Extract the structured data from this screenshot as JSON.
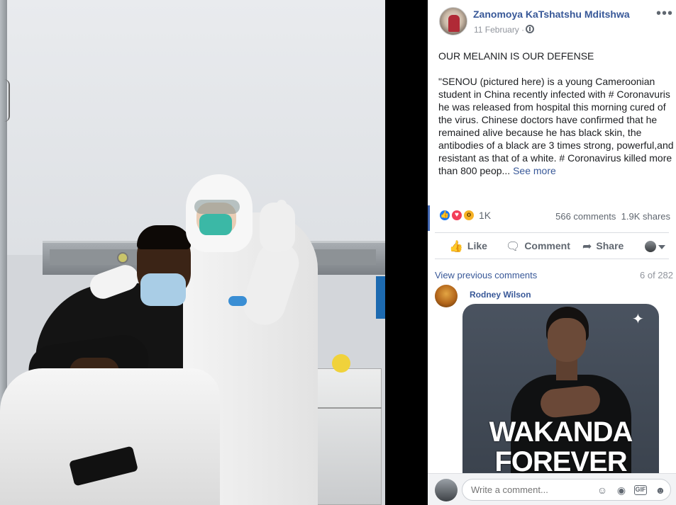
{
  "post": {
    "author": "Zanomoya KaTshatshu Mditshwa",
    "date": "11 February",
    "date_separator": "·",
    "more_icon": "•••",
    "headline": "OUR MELANIN IS OUR DEFENSE",
    "body": "\"SENOU (pictured here) is a young Cameroonian student in China recently infected with # Coronavuris he was released from hospital this morning cured of the virus. Chinese doctors have confirmed that he remained alive because he has black skin, the antibodies of a black are 3 times strong, powerful,and resistant as that of a white. # Coronavirus killed more than 800 peop...",
    "see_more": "See more"
  },
  "reactions": {
    "count": "1K",
    "comments": "566 comments",
    "shares": "1.9K shares",
    "icons": [
      "like-icon",
      "love-icon",
      "wow-icon"
    ]
  },
  "actions": {
    "like": "Like",
    "comment": "Comment",
    "share": "Share"
  },
  "comments": {
    "view_previous": "View previous comments",
    "count": "6 of 282",
    "items": [
      {
        "name": "Rodney Wilson",
        "gif_text": "WAKANDA FOREVER"
      }
    ]
  },
  "composer": {
    "placeholder": "Write a comment...",
    "gif_label": "GIF"
  },
  "colors": {
    "link": "#385898",
    "secondary_text": "#606770",
    "like_blue": "#1877f2",
    "love_red": "#f33e58",
    "wow_yellow": "#f7b125"
  }
}
